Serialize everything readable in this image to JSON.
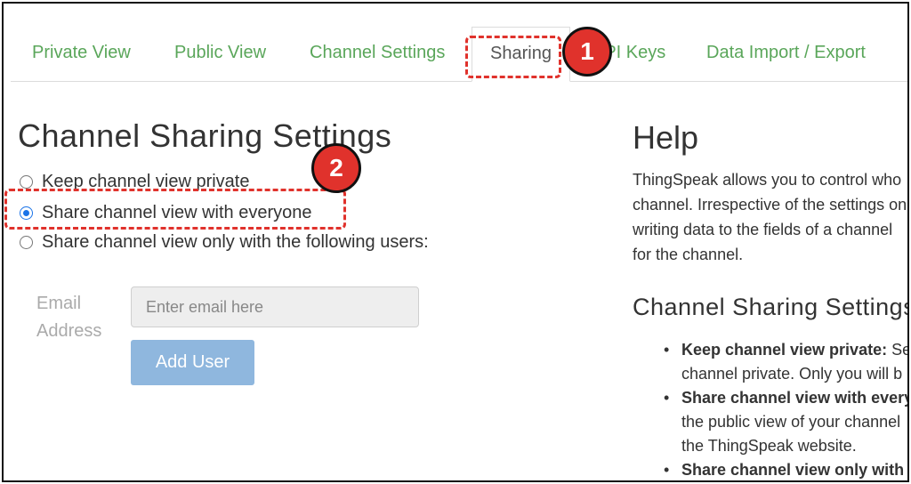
{
  "tabs": [
    {
      "label": "Private View"
    },
    {
      "label": "Public View"
    },
    {
      "label": "Channel Settings"
    },
    {
      "label": "Sharing"
    },
    {
      "label": "API Keys"
    },
    {
      "label": "Data Import / Export"
    }
  ],
  "sharing": {
    "title": "Channel Sharing Settings",
    "options": [
      {
        "label": "Keep channel view private",
        "checked": false
      },
      {
        "label": "Share channel view with everyone",
        "checked": true
      },
      {
        "label": "Share channel view only with the following users:",
        "checked": false
      }
    ],
    "email_label_1": "Email",
    "email_label_2": "Address",
    "email_placeholder": "Enter email here",
    "add_user_label": "Add User"
  },
  "help": {
    "title": "Help",
    "paragraph_lines": [
      "ThingSpeak allows you to control who",
      "channel. Irrespective of the settings on",
      "writing data to the fields of a channel",
      "for the channel."
    ],
    "subtitle": "Channel Sharing Settings",
    "items": [
      {
        "bold": "Keep channel view private:",
        "text": " Sele",
        "line2": "channel private. Only you will b"
      },
      {
        "bold": "Share channel view with everyo",
        "text": "",
        "line2": "the public view of your channel",
        "line3": "the ThingSpeak website."
      },
      {
        "bold": "Share channel view only with th",
        "text": ""
      }
    ]
  },
  "annotations": {
    "badge_1": "1",
    "badge_2": "2",
    "color": "#e0322c"
  },
  "colors": {
    "tab_link": "#5aa65a",
    "radio_checked": "#1a73e8",
    "button": "#8fb7de"
  }
}
